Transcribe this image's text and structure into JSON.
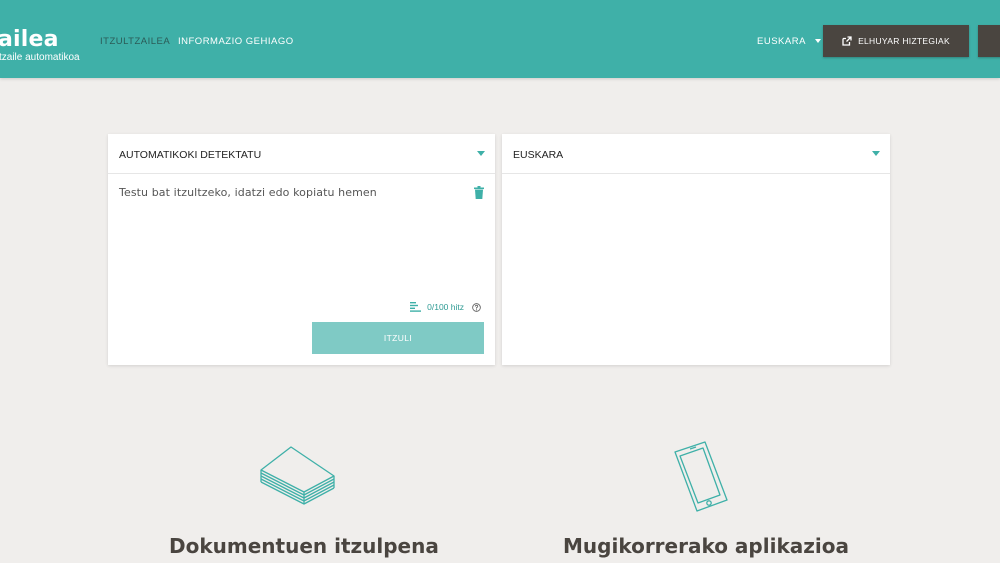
{
  "header": {
    "brand_title": "ailea",
    "brand_subtitle": "tzaile automatikoa",
    "nav": {
      "translator": "ITZULTZAILEA",
      "more_info": "INFORMAZIO GEHIAGO"
    },
    "language": "EUSKARA",
    "hiztegiak_button": "ELHUYAR HIZTEGIAK",
    "colors": {
      "bar": "#3fb0a8",
      "active_nav": "#2b5b57",
      "dark_button": "#4a4540"
    }
  },
  "source_panel": {
    "language": "AUTOMATIKOKI DETEKTATU",
    "placeholder": "Testu bat itzultzeko, idatzi edo kopiatu hemen",
    "word_count": "0/100 hitz",
    "translate_button": "ITZULI",
    "icons": [
      "chevron-down-icon",
      "trash-icon",
      "text-lines-icon",
      "help-icon"
    ]
  },
  "target_panel": {
    "language": "EUSKARA",
    "output": ""
  },
  "features": {
    "documents_title": "Dokumentuen itzulpena",
    "app_title": "Mugikorrerako aplikazioa",
    "icons": [
      "documents-icon",
      "smartphone-icon"
    ]
  }
}
